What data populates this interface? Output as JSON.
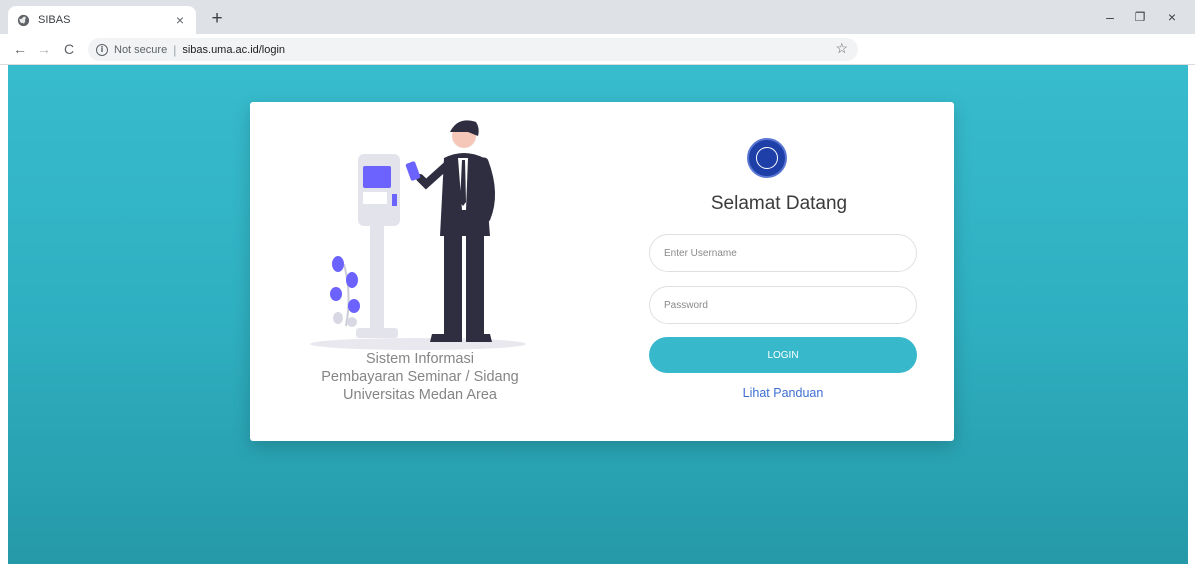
{
  "browser": {
    "tab_title": "SIBAS",
    "tab_close": "×",
    "new_tab": "+",
    "security_label": "Not secure",
    "separator": "|",
    "url": "sibas.uma.ac.id/login",
    "minimize": "–",
    "maximize": "❐",
    "close": "×",
    "back": "←",
    "forward": "→",
    "reload": "C",
    "star": "☆",
    "icons": {
      "favicon": "globe-icon",
      "info": "info-icon",
      "bookmark": "star-icon"
    }
  },
  "login": {
    "caption_line1": "Sistem Informasi",
    "caption_line2": "Pembayaran Seminar / Sidang",
    "caption_line3": "Universitas Medan Area",
    "welcome": "Selamat Datang",
    "username_placeholder": "Enter Username",
    "password_placeholder": "Password",
    "login_label": "LOGIN",
    "guide_link": "Lihat Panduan"
  },
  "colors": {
    "background": "#2fb0c1",
    "accent": "#37b9cb",
    "link": "#3d6fd1",
    "logo": "#1f3fa8"
  }
}
